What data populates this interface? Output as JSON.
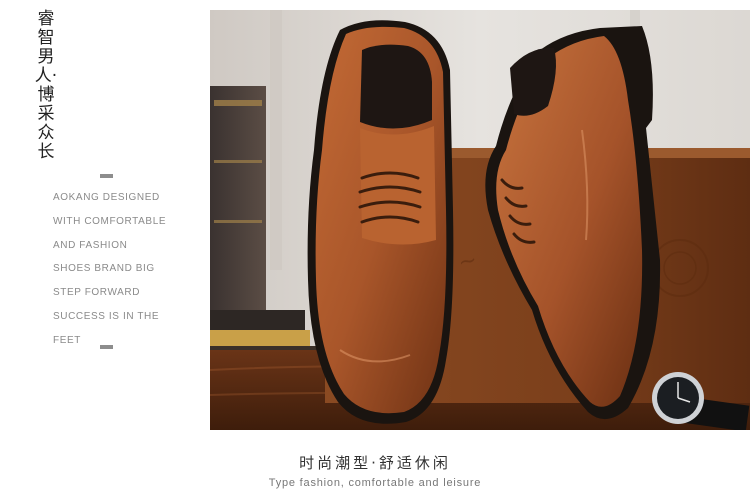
{
  "brand": {
    "vertical_title": "睿智男人·博采众长"
  },
  "slogan": [
    "AOKANG DESIGNED",
    "WITH COMFORTABLE",
    "AND FASHION",
    "SHOES BRAND BIG",
    "STEP FORWARD",
    "SUCCESS IS IN THE",
    "FEET"
  ],
  "caption": {
    "cn": "时尚潮型·舒适休闲",
    "en": "Type fashion, comfortable and leisure"
  },
  "photo": {
    "subject": "brown-leather-derby-shoes-icon",
    "colors": {
      "leather": "#a9562a",
      "sole": "#1a1410",
      "wood": "#7a3f1c",
      "background": "#d9d6d2"
    }
  }
}
